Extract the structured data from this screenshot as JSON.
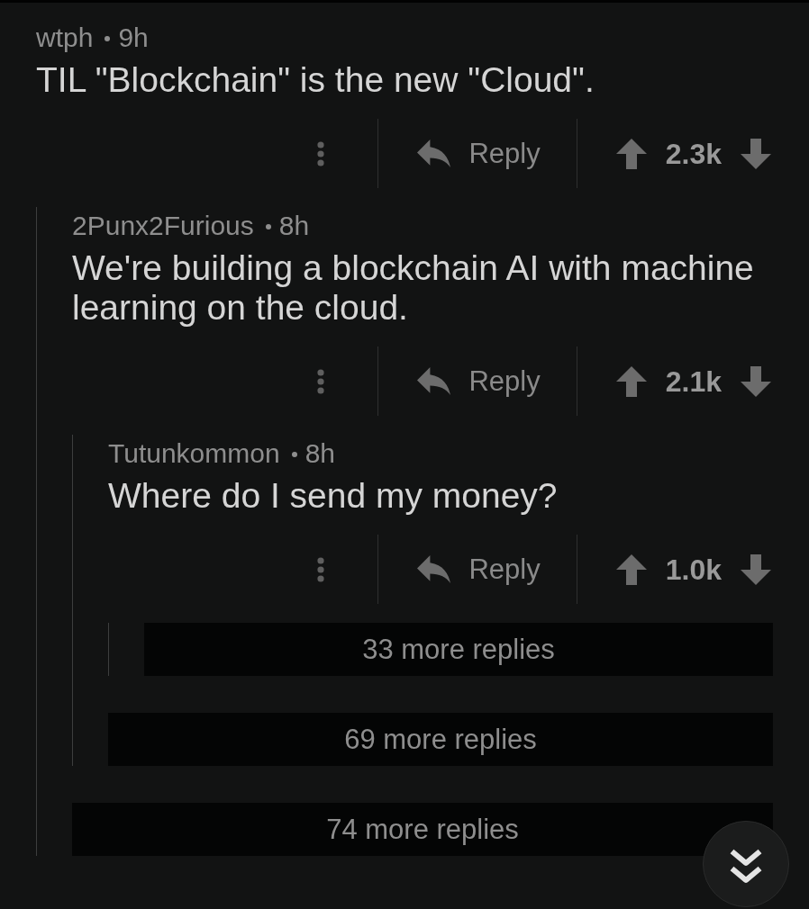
{
  "comments": [
    {
      "author": "wtph",
      "age": "9h",
      "body": "TIL \"Blockchain\" is the new \"Cloud\".",
      "reply": "Reply",
      "score": "2.3k",
      "children": [
        {
          "author": "2Punx2Furious",
          "age": "8h",
          "body": "We're building a blockchain AI with machine learning on the cloud.",
          "reply": "Reply",
          "score": "2.1k",
          "children": [
            {
              "author": "Tutunkommon",
              "age": "8h",
              "body": "Where do I send my money?",
              "reply": "Reply",
              "score": "1.0k",
              "more_replies": "33 more replies"
            }
          ],
          "more_replies": "69 more replies"
        }
      ],
      "more_replies": "74 more replies"
    }
  ]
}
